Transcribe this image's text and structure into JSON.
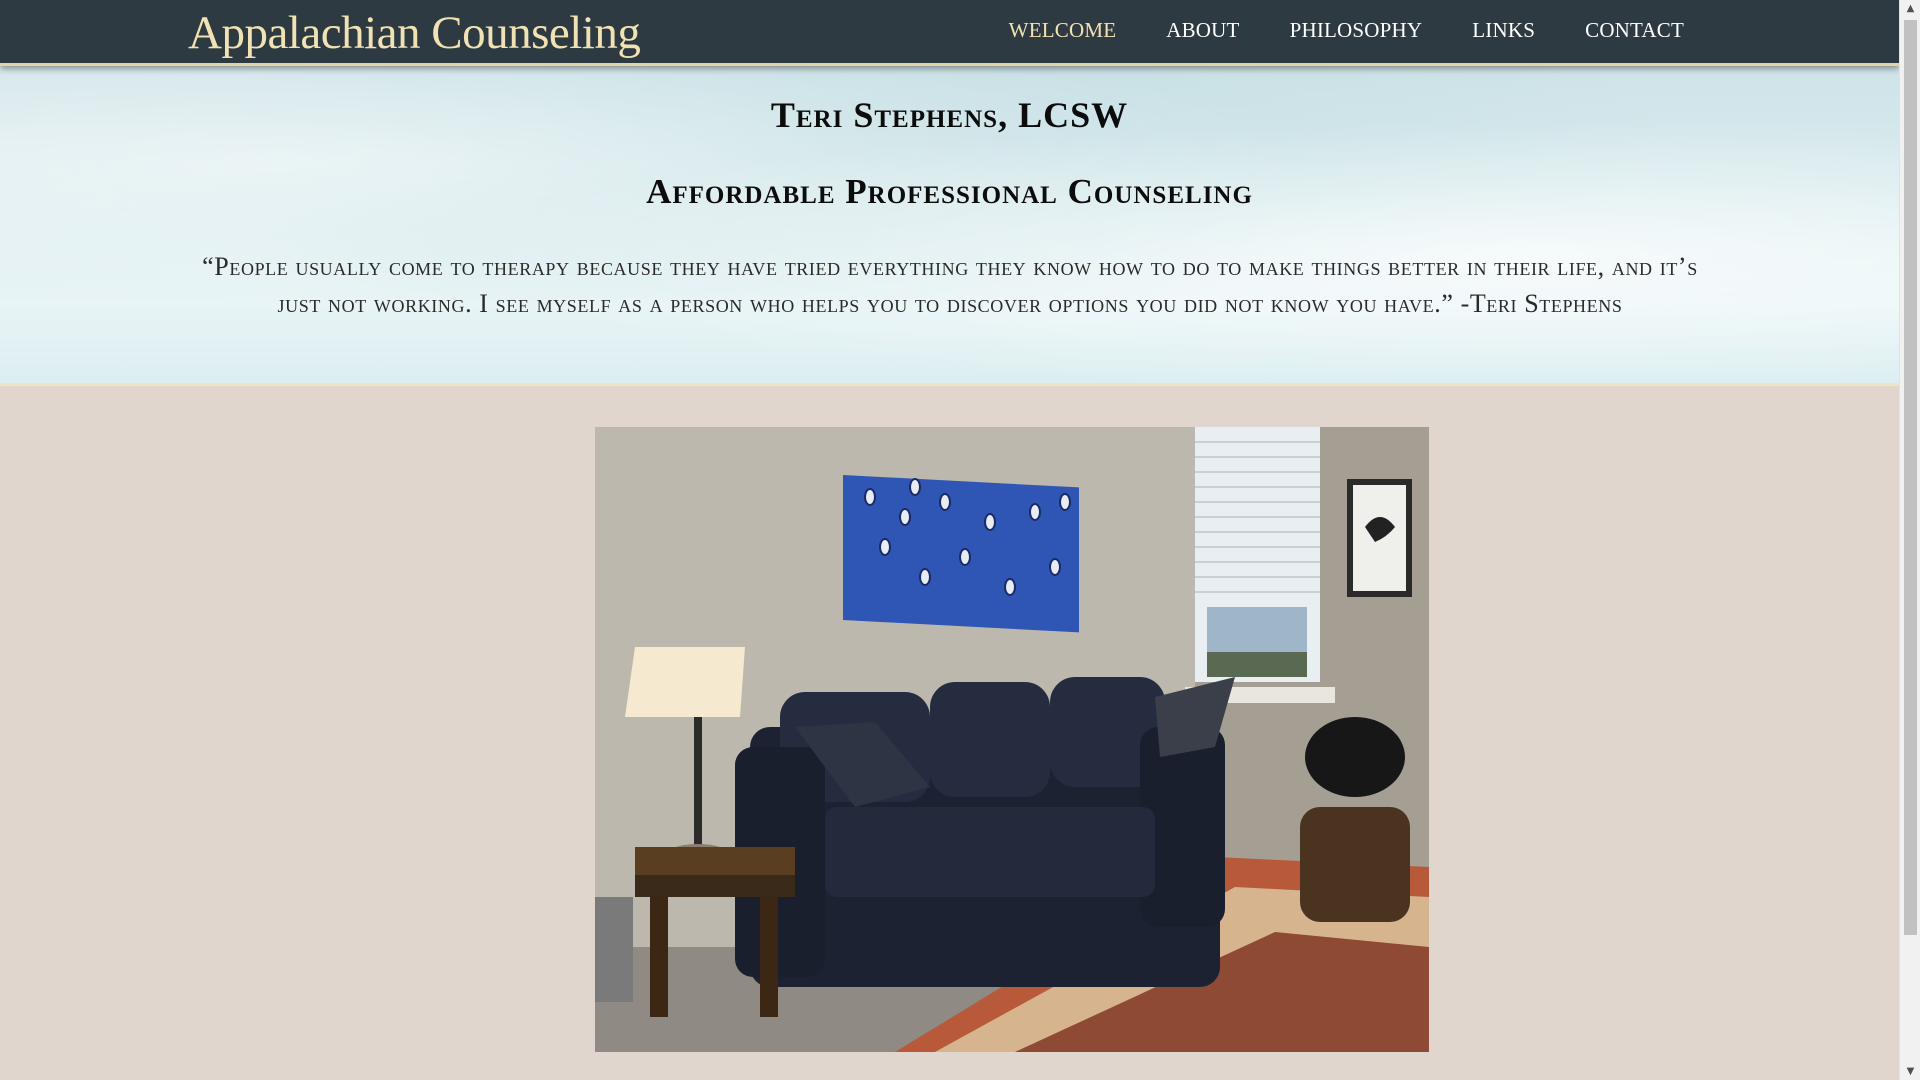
{
  "nav": {
    "brand": "Appalachian Counseling",
    "links": [
      {
        "label": "WELCOME",
        "active": true
      },
      {
        "label": "ABOUT",
        "active": false
      },
      {
        "label": "PHILOSOPHY",
        "active": false
      },
      {
        "label": "LINKS",
        "active": false
      },
      {
        "label": "CONTACT",
        "active": false
      }
    ]
  },
  "hero": {
    "title": "Teri Stephens, LCSW",
    "subtitle": "Affordable Professional Counseling",
    "quote": "“People usually come to therapy because they have tried everything they know how to do to make things better in their life, and it’s just not working. I see myself as a person who helps you to discover options you did not know you have.” -Teri Stephens"
  },
  "colors": {
    "navbar": "#2e3a42",
    "brand": "#f1e2b4",
    "accent_border": "#e4d3a4",
    "page_background": "#e0d6cd"
  },
  "scrollbar": {
    "up_arrow": "▲",
    "down_arrow": "▼"
  }
}
